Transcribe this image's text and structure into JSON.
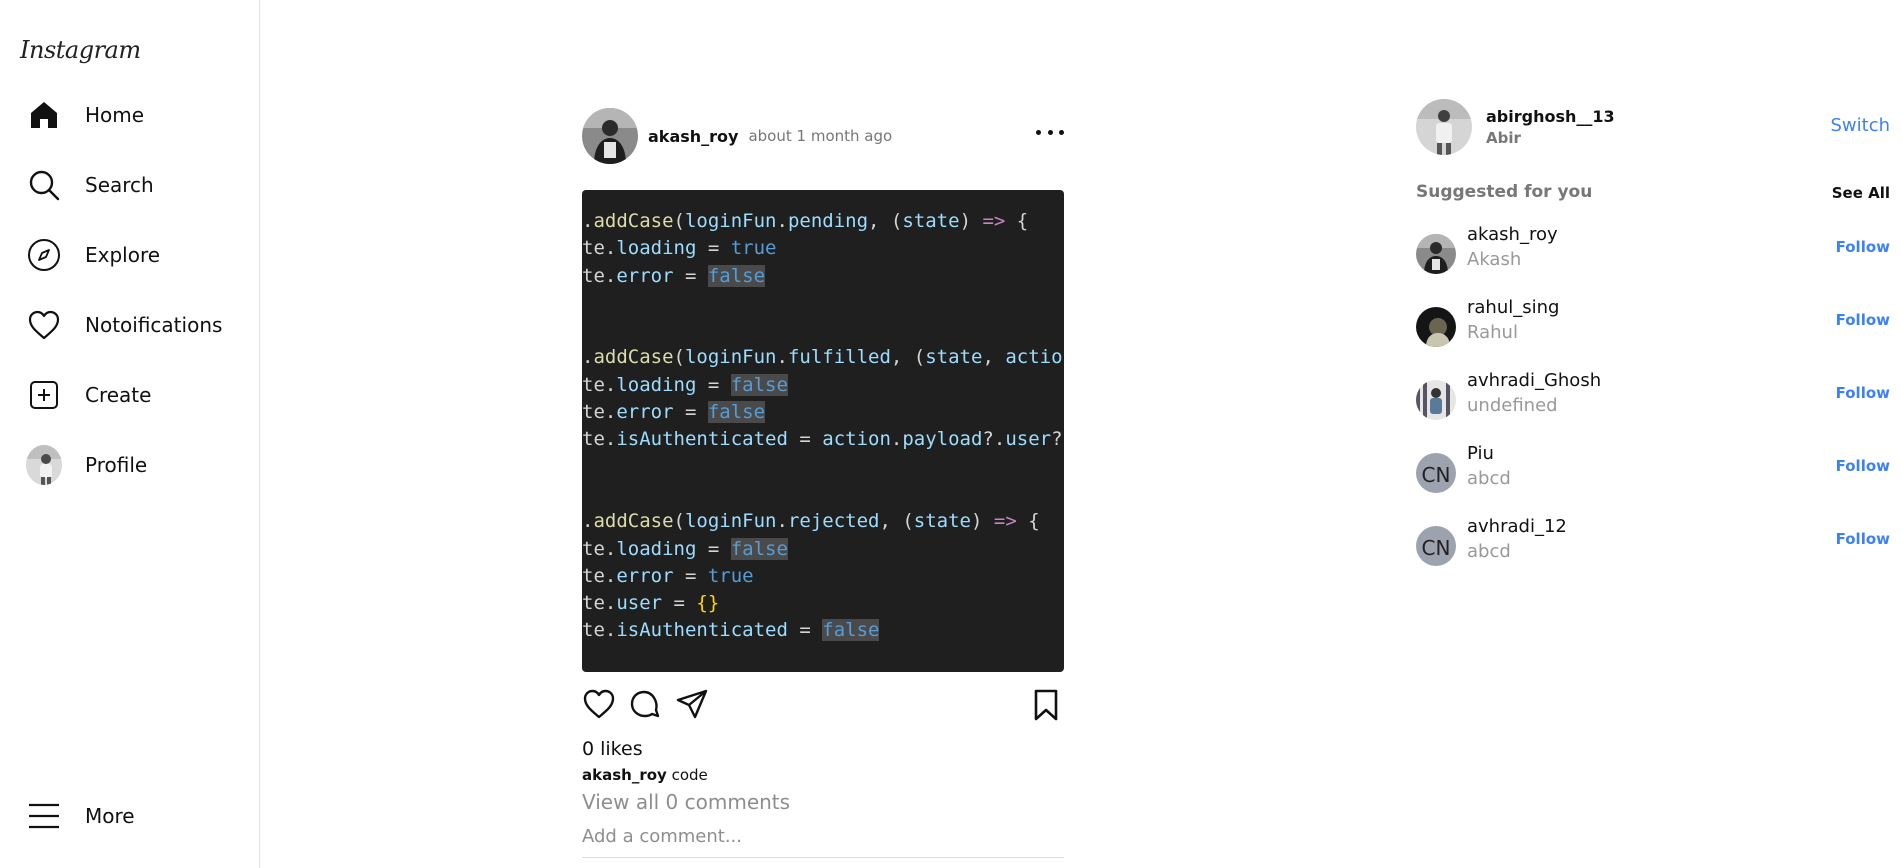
{
  "brand": {
    "logo_text": "Instagram"
  },
  "sidebar": {
    "items": [
      {
        "label": "Home",
        "icon": "home-icon"
      },
      {
        "label": "Search",
        "icon": "search-icon"
      },
      {
        "label": "Explore",
        "icon": "compass-icon"
      },
      {
        "label": "Notoifications",
        "icon": "heart-icon"
      },
      {
        "label": "Create",
        "icon": "plus-square-icon"
      },
      {
        "label": "Profile",
        "icon": "avatar"
      }
    ],
    "more_label": "More"
  },
  "post": {
    "username": "akash_roy",
    "time": "about 1 month ago",
    "image_code_lines": [
      ".addCase(loginFun.pending, (state) => {",
      "te.loading = true",
      "te.error = false",
      "",
      "",
      ".addCase(loginFun.fulfilled, (state, action)",
      "te.loading = false",
      "te.error = false",
      "te.isAuthenticated = action.payload?.user?._",
      "",
      "",
      ".addCase(loginFun.rejected, (state) => {",
      "te.loading = false",
      "te.error = true",
      "te.user = {}",
      "te.isAuthenticated = false"
    ],
    "likes_text": "0 likes",
    "caption_user": "akash_roy",
    "caption_text": "code",
    "view_comments": "View all 0 comments",
    "comment_placeholder": "Add a comment..."
  },
  "current_user": {
    "username": "abirghosh__13",
    "name": "Abir",
    "switch_label": "Switch"
  },
  "suggestions": {
    "title": "Suggested for you",
    "see_all": "See All",
    "follow_label": "Follow",
    "items": [
      {
        "username": "akash_roy",
        "name": "Akash",
        "avatar": "photo"
      },
      {
        "username": "rahul_sing",
        "name": "Rahul",
        "avatar": "photo"
      },
      {
        "username": "avhradi_Ghosh",
        "name": "undefined",
        "avatar": "photo"
      },
      {
        "username": "Piu",
        "name": "abcd",
        "avatar": "CN"
      },
      {
        "username": "avhradi_12",
        "name": "abcd",
        "avatar": "CN"
      }
    ]
  },
  "colors": {
    "accent": "#3b82f6",
    "muted": "#8e8e8e",
    "code_bg": "#1f1f1f"
  }
}
